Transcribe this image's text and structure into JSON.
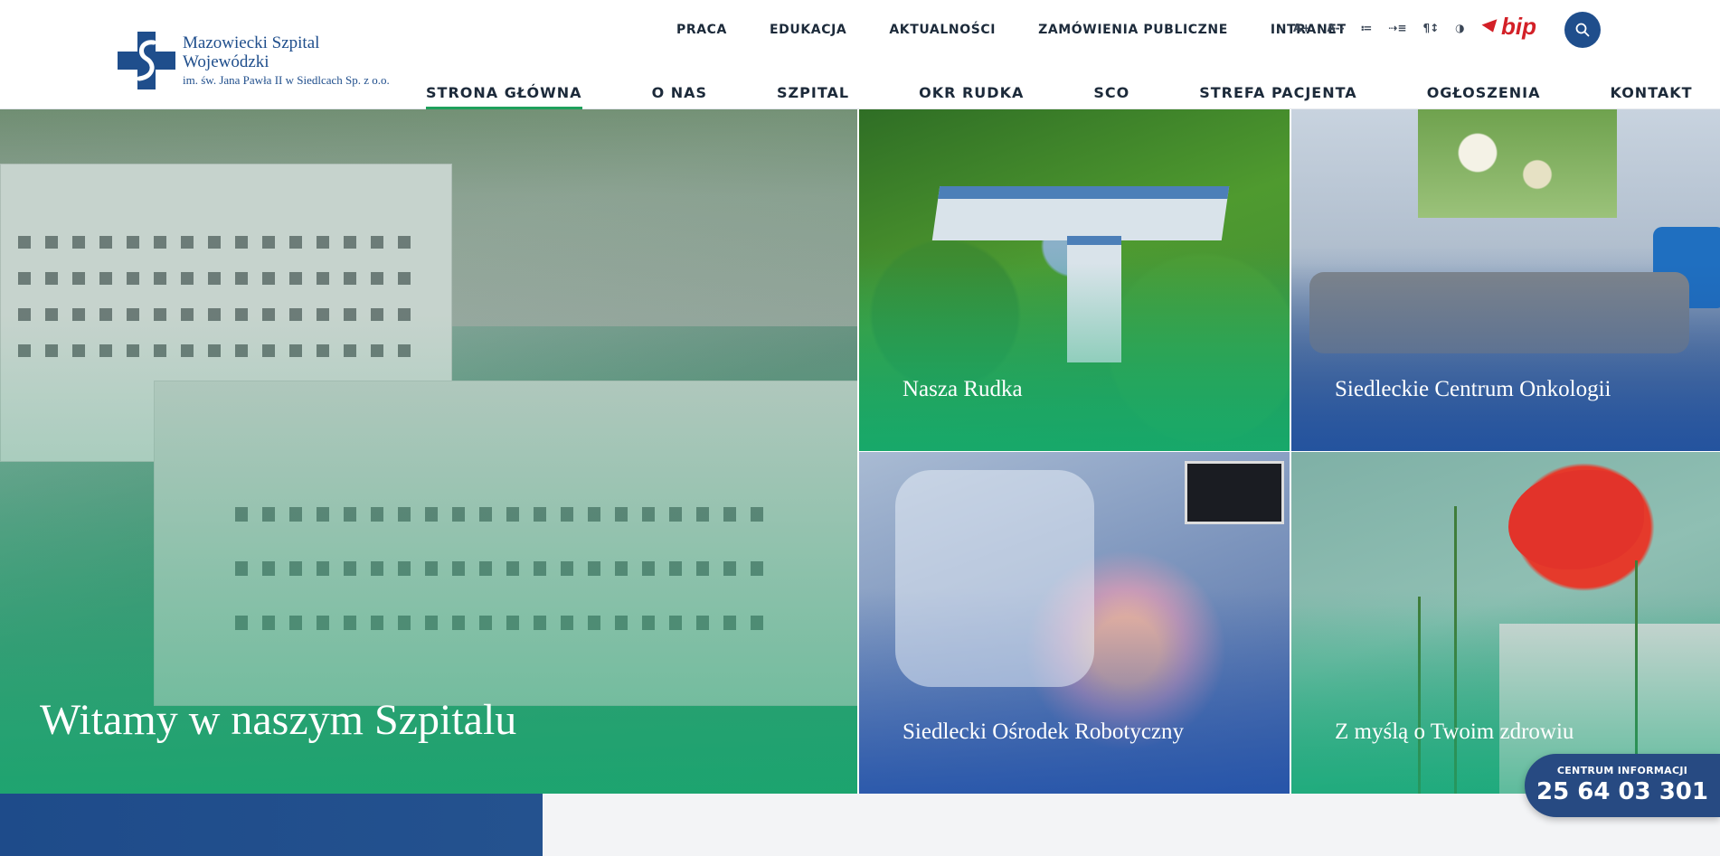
{
  "header": {
    "logo_line1": "Mazowiecki Szpital Wojewódzki",
    "logo_line2": "im. św. Jana Pawła II w Siedlcach Sp. z o.o.",
    "top_nav": [
      "PRACA",
      "EDUKACJA",
      "AKTUALNOŚCI",
      "ZAMÓWIENIA PUBLICZNE",
      "INTRANET"
    ],
    "tools": [
      "A+",
      "A--",
      "≔",
      "⇢≡",
      "¶↕",
      "◑"
    ],
    "bip_label": "bip",
    "main_nav": [
      "STRONA GŁÓWNA",
      "O NAS",
      "SZPITAL",
      "OKR RUDKA",
      "SCO",
      "STREFA PACJENTA",
      "OGŁOSZENIA",
      "KONTAKT"
    ],
    "active_nav": "STRONA GŁÓWNA"
  },
  "hero": {
    "title": "Witamy w naszym Szpitalu"
  },
  "tiles": [
    {
      "label": "Nasza Rudka"
    },
    {
      "label": "Siedleckie Centrum Onkologii"
    },
    {
      "label": "Siedlecki Ośrodek Robotyczny"
    },
    {
      "label": "Z myślą o Twoim zdrowiu"
    }
  ],
  "info": {
    "label": "CENTRUM INFORMACJI",
    "phone": "25 64 03 301"
  },
  "colors": {
    "brand_blue": "#1f4e8c",
    "accent_green": "#1fa05c",
    "bip_red": "#d32027"
  }
}
